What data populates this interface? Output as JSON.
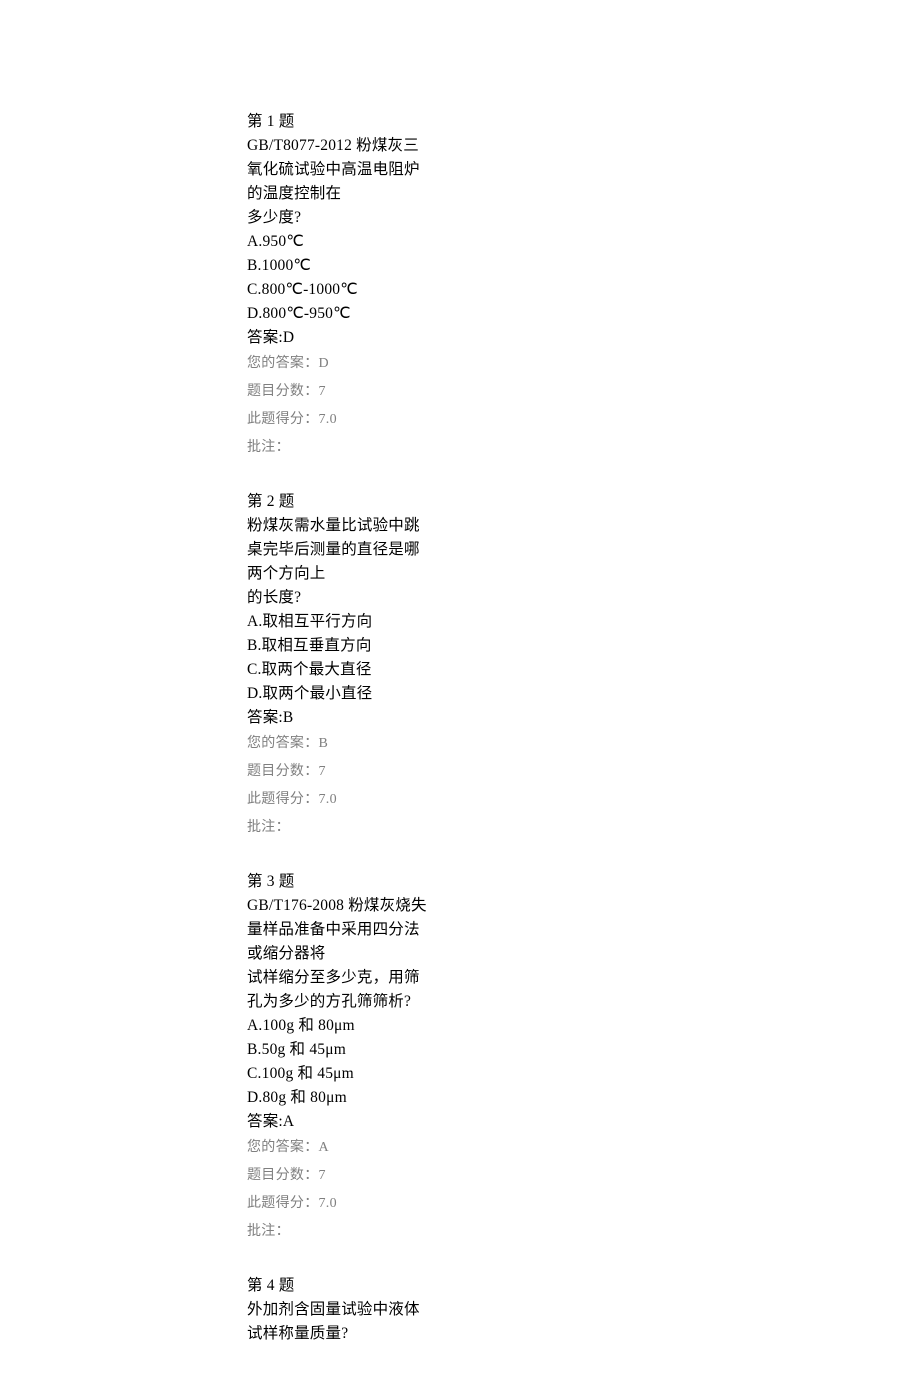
{
  "questions": [
    {
      "title": "第 1 题",
      "stem": [
        "GB/T8077-2012 粉煤灰三氧化硫试验中高温电阻炉的温度控制在",
        "多少度?"
      ],
      "options": [
        "A.950℃",
        "B.1000℃",
        "C.800℃-1000℃",
        "D.800℃-950℃"
      ],
      "answer": "答案:D",
      "meta": [
        "您的答案：D",
        "题目分数：7",
        "此题得分：7.0",
        "批注："
      ]
    },
    {
      "title": "第 2 题",
      "stem": [
        "粉煤灰需水量比试验中跳桌完毕后测量的直径是哪两个方向上",
        "的长度?"
      ],
      "options": [
        "A.取相互平行方向",
        "B.取相互垂直方向",
        "C.取两个最大直径",
        "D.取两个最小直径"
      ],
      "answer": "答案:B",
      "meta": [
        "您的答案：B",
        "题目分数：7",
        "此题得分：7.0",
        "批注："
      ]
    },
    {
      "title": "第 3 题",
      "stem": [
        "GB/T176-2008 粉煤灰烧失量样品准备中采用四分法或缩分器将",
        "试样缩分至多少克，用筛孔为多少的方孔筛筛析?"
      ],
      "options": [
        "A.100g 和 80μm",
        "B.50g 和 45μm",
        "C.100g 和 45μm",
        "D.80g 和 80μm"
      ],
      "answer": "答案:A",
      "meta": [
        "您的答案：A",
        "题目分数：7",
        "此题得分：7.0",
        "批注："
      ]
    },
    {
      "title": "第 4 题",
      "stem": [
        "外加剂含固量试验中液体试样称量质量?"
      ],
      "options": [],
      "answer": "",
      "meta": []
    }
  ]
}
